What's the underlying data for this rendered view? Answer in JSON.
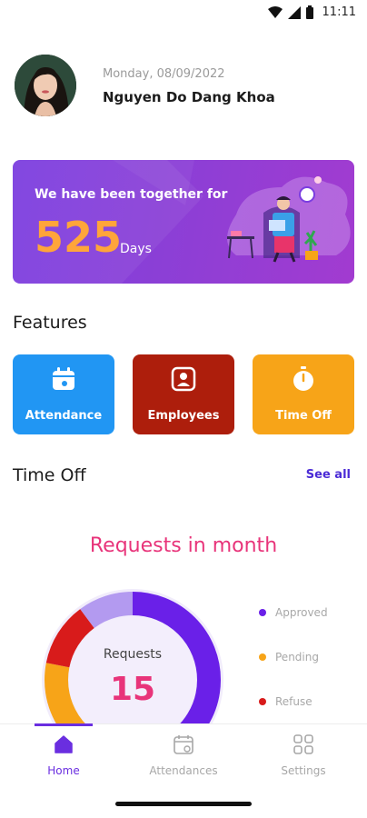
{
  "status_bar": {
    "time": "11:11",
    "icons": [
      "wifi-icon",
      "signal-icon",
      "battery-icon"
    ]
  },
  "profile": {
    "date": "Monday, 08/09/2022",
    "name": "Nguyen Do Dang Khoa"
  },
  "banner": {
    "title": "We have been together for",
    "days": "525",
    "days_label": "Days"
  },
  "features": {
    "title": "Features",
    "items": [
      {
        "label": "Attendance",
        "icon": "calendar-icon",
        "color": "#2196f3"
      },
      {
        "label": "Employees",
        "icon": "id-badge-icon",
        "color": "#ad1e0c"
      },
      {
        "label": "Time Off",
        "icon": "stopwatch-icon",
        "color": "#f7a418"
      }
    ]
  },
  "time_off": {
    "title": "Time Off",
    "see_all": "See all",
    "chart_title": "Requests in month",
    "center_label": "Requests",
    "center_value": "15",
    "legend": [
      {
        "label": "Approved",
        "color": "#6a20e8"
      },
      {
        "label": "Pending",
        "color": "#f7a418"
      },
      {
        "label": "Refuse",
        "color": "#d81b1b"
      }
    ]
  },
  "colors": {
    "accent": "#6a2ee0",
    "highlight": "#e8347a",
    "days": "#ffa53a"
  },
  "nav": {
    "items": [
      {
        "label": "Home",
        "icon": "home-icon",
        "active": true
      },
      {
        "label": "Attendances",
        "icon": "calendar-check-icon",
        "active": false
      },
      {
        "label": "Settings",
        "icon": "grid-icon",
        "active": false
      }
    ]
  }
}
